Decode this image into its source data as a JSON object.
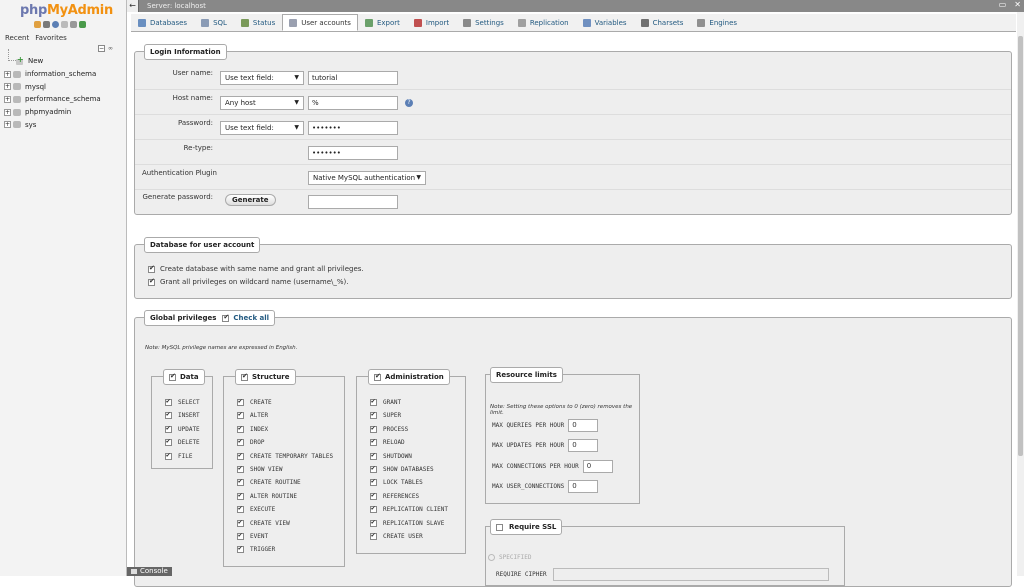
{
  "nav": {
    "logo": {
      "php": "php",
      "my": "My",
      "admin": "Admin"
    },
    "tabs": [
      "Recent",
      "Favorites"
    ],
    "tree": [
      {
        "label": "New",
        "type": "new"
      },
      {
        "label": "information_schema",
        "type": "db"
      },
      {
        "label": "mysql",
        "type": "db"
      },
      {
        "label": "performance_schema",
        "type": "db"
      },
      {
        "label": "phpmyadmin",
        "type": "db"
      },
      {
        "label": "sys",
        "type": "db"
      }
    ]
  },
  "topbar": {
    "server_label": "Server: localhost"
  },
  "tabs": [
    {
      "label": "Databases",
      "icon": "databases-icon",
      "color": "#6a8fc0"
    },
    {
      "label": "SQL",
      "icon": "sql-icon",
      "color": "#8a9bb5"
    },
    {
      "label": "Status",
      "icon": "status-icon",
      "color": "#7a9a5a"
    },
    {
      "label": "User accounts",
      "icon": "users-icon",
      "color": "#9aa0b0",
      "active": true
    },
    {
      "label": "Export",
      "icon": "export-icon",
      "color": "#6aa06a"
    },
    {
      "label": "Import",
      "icon": "import-icon",
      "color": "#c05050"
    },
    {
      "label": "Settings",
      "icon": "settings-icon",
      "color": "#8a8a8a"
    },
    {
      "label": "Replication",
      "icon": "replication-icon",
      "color": "#a0a0a0"
    },
    {
      "label": "Variables",
      "icon": "variables-icon",
      "color": "#7090c0"
    },
    {
      "label": "Charsets",
      "icon": "charsets-icon",
      "color": "#707070"
    },
    {
      "label": "Engines",
      "icon": "engines-icon",
      "color": "#909090"
    }
  ],
  "login": {
    "legend": "Login Information",
    "user_name": {
      "label": "User name:",
      "select": "Use text field:",
      "value": "tutorial"
    },
    "host_name": {
      "label": "Host name:",
      "select": "Any host",
      "value": "%"
    },
    "password": {
      "label": "Password:",
      "select": "Use text field:",
      "value": "•••••••"
    },
    "retype": {
      "label": "Re-type:",
      "value": "•••••••"
    },
    "auth_plugin": {
      "label": "Authentication Plugin",
      "select": "Native MySQL authentication"
    },
    "generate": {
      "label": "Generate password:",
      "button": "Generate",
      "value": ""
    }
  },
  "db_for_user": {
    "legend": "Database for user account",
    "options": [
      {
        "label": "Create database with same name and grant all privileges.",
        "checked": true
      },
      {
        "label": "Grant all privileges on wildcard name (username\\_%).",
        "checked": true
      }
    ]
  },
  "global_privileges": {
    "legend": "Global privileges",
    "check_all": "Check all",
    "note": "Note: MySQL privilege names are expressed in English.",
    "data": {
      "legend": "Data",
      "items": [
        "SELECT",
        "INSERT",
        "UPDATE",
        "DELETE",
        "FILE"
      ]
    },
    "structure": {
      "legend": "Structure",
      "items": [
        "CREATE",
        "ALTER",
        "INDEX",
        "DROP",
        "CREATE TEMPORARY TABLES",
        "SHOW VIEW",
        "CREATE ROUTINE",
        "ALTER ROUTINE",
        "EXECUTE",
        "CREATE VIEW",
        "EVENT",
        "TRIGGER"
      ]
    },
    "administration": {
      "legend": "Administration",
      "items": [
        "GRANT",
        "SUPER",
        "PROCESS",
        "RELOAD",
        "SHUTDOWN",
        "SHOW DATABASES",
        "LOCK TABLES",
        "REFERENCES",
        "REPLICATION CLIENT",
        "REPLICATION SLAVE",
        "CREATE USER"
      ]
    },
    "resource_limits": {
      "legend": "Resource limits",
      "note": "Note: Setting these options to 0 (zero) removes the limit.",
      "items": [
        {
          "label": "MAX QUERIES PER HOUR",
          "value": "0"
        },
        {
          "label": "MAX UPDATES PER HOUR",
          "value": "0"
        },
        {
          "label": "MAX CONNECTIONS PER HOUR",
          "value": "0"
        },
        {
          "label": "MAX USER_CONNECTIONS",
          "value": "0"
        }
      ]
    },
    "ssl": {
      "legend": "Require SSL",
      "specified": "SPECIFIED",
      "require_cipher": "REQUIRE CIPHER"
    }
  },
  "console": {
    "label": "Console"
  }
}
